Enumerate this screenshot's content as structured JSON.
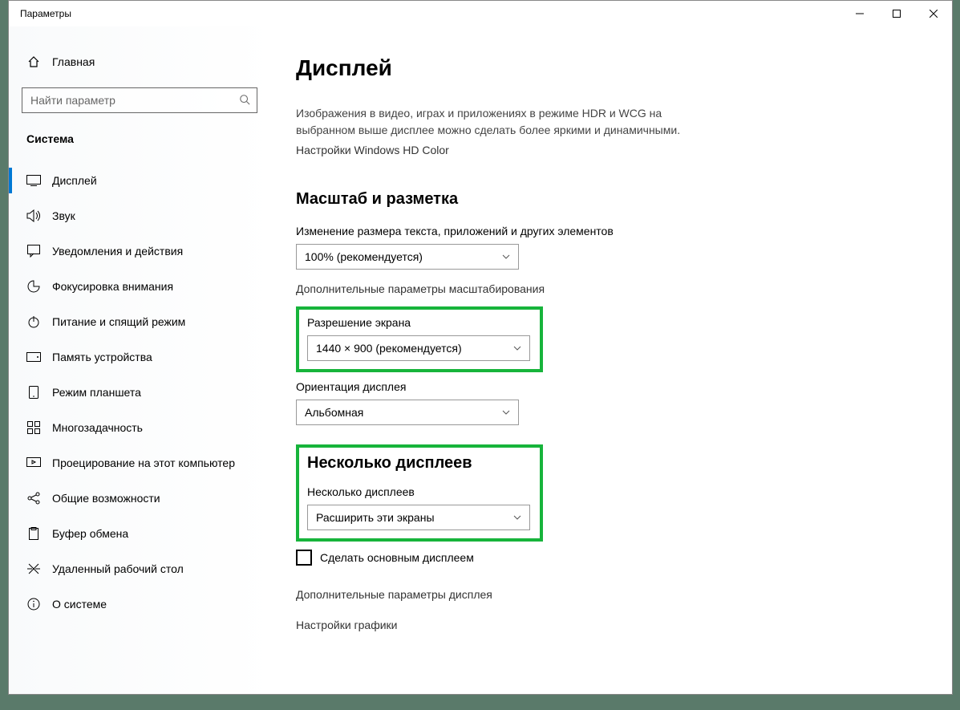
{
  "window": {
    "title": "Параметры"
  },
  "sidebar": {
    "home": "Главная",
    "search_placeholder": "Найти параметр",
    "category": "Система",
    "items": [
      {
        "label": "Дисплей"
      },
      {
        "label": "Звук"
      },
      {
        "label": "Уведомления и действия"
      },
      {
        "label": "Фокусировка внимания"
      },
      {
        "label": "Питание и спящий режим"
      },
      {
        "label": "Память устройства"
      },
      {
        "label": "Режим планшета"
      },
      {
        "label": "Многозадачность"
      },
      {
        "label": "Проецирование на этот компьютер"
      },
      {
        "label": "Общие возможности"
      },
      {
        "label": "Буфер обмена"
      },
      {
        "label": "Удаленный рабочий стол"
      },
      {
        "label": "О системе"
      }
    ]
  },
  "main": {
    "title": "Дисплей",
    "hdr_desc": "Изображения в видео, играх и приложениях в режиме HDR и WCG на выбранном выше дисплее можно сделать более яркими и динамичными.",
    "hdr_link": "Настройки Windows HD Color",
    "scale_heading": "Масштаб и разметка",
    "scale_label": "Изменение размера текста, приложений и других элементов",
    "scale_value": "100% (рекомендуется)",
    "scale_link": "Дополнительные параметры масштабирования",
    "res_label": "Разрешение экрана",
    "res_value": "1440 × 900 (рекомендуется)",
    "orient_label": "Ориентация дисплея",
    "orient_value": "Альбомная",
    "multi_heading": "Несколько дисплеев",
    "multi_label": "Несколько дисплеев",
    "multi_value": "Расширить эти экраны",
    "make_main": "Сделать основным дисплеем",
    "adv_display": "Дополнительные параметры дисплея",
    "gfx_settings": "Настройки графики"
  }
}
